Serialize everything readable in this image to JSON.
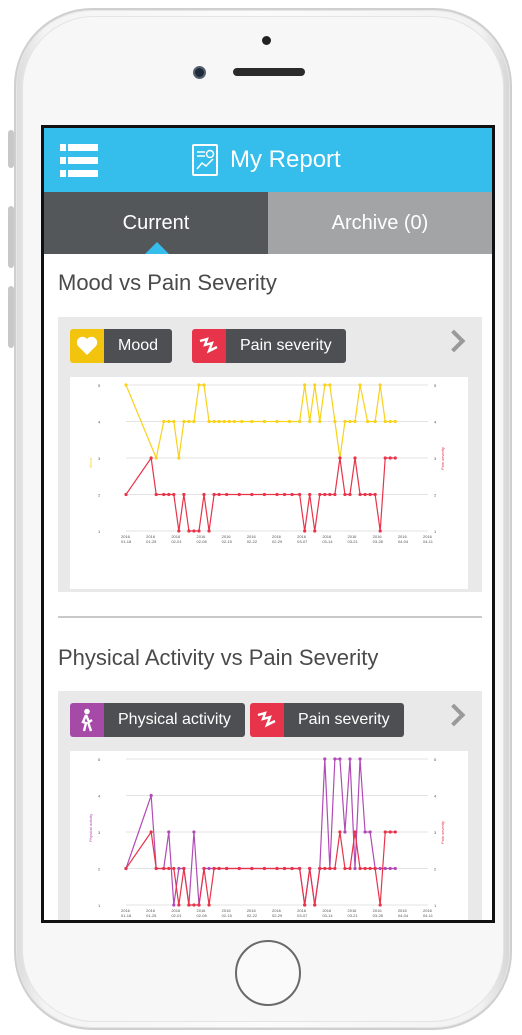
{
  "header": {
    "title": "My Report"
  },
  "tabs": {
    "current": "Current",
    "archive": "Archive (0)"
  },
  "sections": [
    {
      "title": "Mood vs Pain Severity",
      "chips": [
        {
          "label": "Mood",
          "icon": "heart-icon",
          "color": "#f2c40e"
        },
        {
          "label": "Pain severity",
          "icon": "pain-icon",
          "color": "#e8344a"
        }
      ]
    },
    {
      "title": "Physical Activity vs Pain Severity",
      "chips": [
        {
          "label": "Physical activity",
          "icon": "walking-person-icon",
          "color": "#a64aa8"
        },
        {
          "label": "Pain severity",
          "icon": "pain-icon",
          "color": "#e8344a"
        }
      ]
    }
  ],
  "colors": {
    "topbar": "#35bdeb",
    "mood": "#f9d21b",
    "pain": "#e8344a",
    "activity": "#b14bb5"
  },
  "chart_data": [
    {
      "type": "line",
      "xlabel": "",
      "ylabel_left": "Mood",
      "ylabel_right": "Pain severity",
      "ylim": [
        1,
        5
      ],
      "yticks": [
        "1",
        "2",
        "3",
        "4",
        "5"
      ],
      "xticks": [
        [
          "2016",
          "01-18"
        ],
        [
          "2016",
          "01-25"
        ],
        [
          "2016",
          "02-01"
        ],
        [
          "2016",
          "02-08"
        ],
        [
          "2016",
          "02-15"
        ],
        [
          "2016",
          "02-22"
        ],
        [
          "2016",
          "02-29"
        ],
        [
          "2016",
          "03-07"
        ],
        [
          "2016",
          "03-14"
        ],
        [
          "2016",
          "03-21"
        ],
        [
          "2016",
          "03-28"
        ],
        [
          "2016",
          "04-04"
        ],
        [
          "2016",
          "04-11"
        ]
      ],
      "series": [
        {
          "name": "Mood",
          "x": [
            1,
            2.2,
            2.5,
            2.7,
            2.9,
            3.1,
            3.3,
            3.5,
            3.7,
            3.9,
            4.1,
            4.3,
            4.5,
            4.7,
            4.9,
            5.1,
            5.3,
            5.6,
            6,
            6.5,
            7,
            7.5,
            7.9,
            8.1,
            8.3,
            8.5,
            8.7,
            8.9,
            9.1,
            9.3,
            9.5,
            9.7,
            9.9,
            10.1,
            10.3,
            10.6,
            10.9,
            11.1,
            11.3,
            11.5,
            11.7
          ],
          "values": [
            5,
            3,
            4,
            4,
            4,
            3,
            4,
            4,
            4,
            5,
            5,
            4,
            4,
            4,
            4,
            4,
            4,
            4,
            4,
            4,
            4,
            4,
            4,
            5,
            4,
            5,
            4,
            5,
            5,
            4,
            3,
            4,
            4,
            4,
            5,
            4,
            4,
            5,
            4,
            4,
            4
          ]
        },
        {
          "name": "Pain severity",
          "x": [
            1,
            2,
            2.2,
            2.5,
            2.7,
            2.9,
            3.1,
            3.3,
            3.5,
            3.7,
            3.9,
            4.1,
            4.3,
            4.5,
            4.7,
            5,
            5.5,
            6,
            6.5,
            7,
            7.3,
            7.6,
            7.9,
            8.1,
            8.3,
            8.5,
            8.7,
            8.9,
            9.1,
            9.3,
            9.5,
            9.7,
            9.9,
            10.1,
            10.3,
            10.5,
            10.7,
            10.9,
            11.1,
            11.3,
            11.5,
            11.7
          ],
          "values": [
            2,
            3,
            2,
            2,
            2,
            2,
            1,
            2,
            1,
            1,
            1,
            2,
            1,
            2,
            2,
            2,
            2,
            2,
            2,
            2,
            2,
            2,
            2,
            1,
            2,
            1,
            2,
            2,
            2,
            2,
            3,
            2,
            2,
            3,
            2,
            2,
            2,
            2,
            1,
            3,
            3,
            3
          ]
        }
      ]
    },
    {
      "type": "line",
      "xlabel": "",
      "ylabel_left": "Physical activity",
      "ylabel_right": "Pain severity",
      "ylim": [
        1,
        5
      ],
      "yticks": [
        "1",
        "2",
        "3",
        "4",
        "5"
      ],
      "xticks": [
        [
          "2016",
          "01-18"
        ],
        [
          "2016",
          "01-25"
        ],
        [
          "2016",
          "02-01"
        ],
        [
          "2016",
          "02-08"
        ],
        [
          "2016",
          "02-15"
        ],
        [
          "2016",
          "02-22"
        ],
        [
          "2016",
          "02-29"
        ],
        [
          "2016",
          "03-07"
        ],
        [
          "2016",
          "03-14"
        ],
        [
          "2016",
          "03-21"
        ],
        [
          "2016",
          "03-28"
        ],
        [
          "2016",
          "04-04"
        ],
        [
          "2016",
          "04-11"
        ]
      ],
      "series": [
        {
          "name": "Physical activity",
          "x": [
            1,
            2,
            2.2,
            2.5,
            2.7,
            2.9,
            3.1,
            3.3,
            3.5,
            3.7,
            3.9,
            4.1,
            4.3,
            4.5,
            4.7,
            5,
            5.5,
            6,
            6.5,
            7,
            7.3,
            7.6,
            7.9,
            8.1,
            8.3,
            8.5,
            8.7,
            8.9,
            9.1,
            9.3,
            9.5,
            9.7,
            9.9,
            10.1,
            10.3,
            10.5,
            10.7,
            10.9,
            11.1,
            11.3,
            11.5,
            11.7
          ],
          "values": [
            2,
            4,
            2,
            2,
            3,
            1,
            2,
            2,
            1,
            3,
            1,
            2,
            2,
            2,
            2,
            2,
            2,
            2,
            2,
            2,
            2,
            2,
            2,
            1,
            2,
            1,
            2,
            5,
            2,
            5,
            5,
            3,
            5,
            2,
            5,
            3,
            3,
            2,
            2,
            2,
            2,
            2
          ]
        },
        {
          "name": "Pain severity",
          "x": [
            1,
            2,
            2.2,
            2.5,
            2.7,
            2.9,
            3.1,
            3.3,
            3.5,
            3.7,
            3.9,
            4.1,
            4.3,
            4.5,
            4.7,
            5,
            5.5,
            6,
            6.5,
            7,
            7.3,
            7.6,
            7.9,
            8.1,
            8.3,
            8.5,
            8.7,
            8.9,
            9.1,
            9.3,
            9.5,
            9.7,
            9.9,
            10.1,
            10.3,
            10.5,
            10.7,
            10.9,
            11.1,
            11.3,
            11.5,
            11.7
          ],
          "values": [
            2,
            3,
            2,
            2,
            2,
            2,
            1,
            2,
            1,
            1,
            1,
            2,
            1,
            2,
            2,
            2,
            2,
            2,
            2,
            2,
            2,
            2,
            2,
            1,
            2,
            1,
            2,
            2,
            2,
            2,
            3,
            2,
            2,
            3,
            2,
            2,
            2,
            2,
            1,
            3,
            3,
            3
          ]
        }
      ]
    }
  ]
}
